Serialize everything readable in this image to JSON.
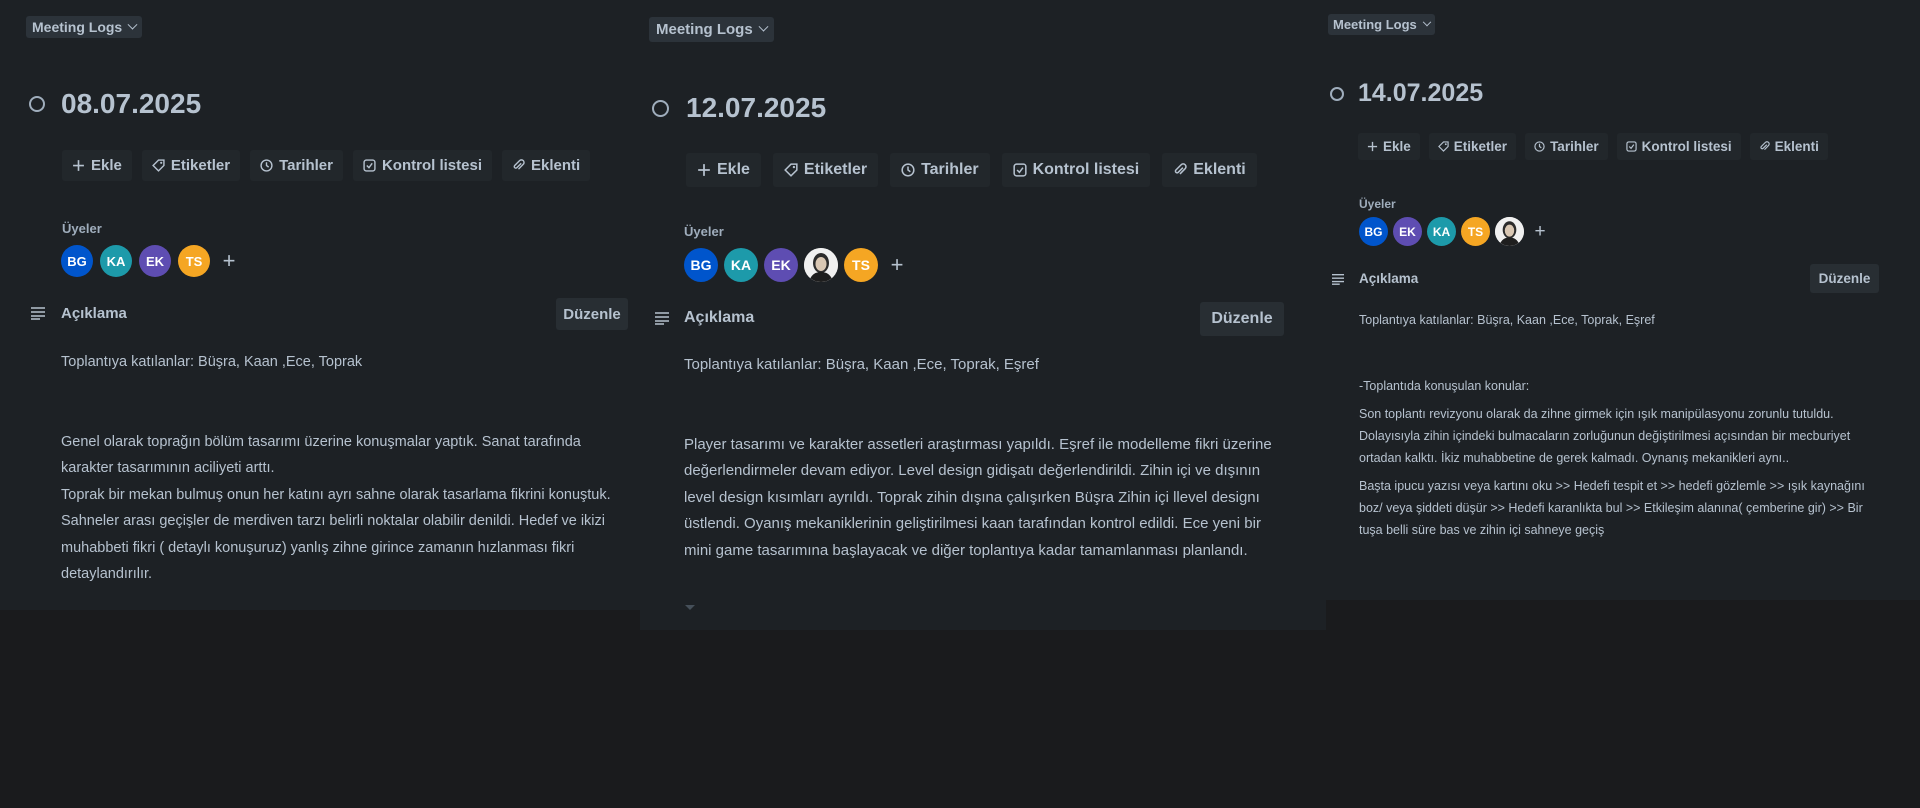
{
  "colors": {
    "background": "#1d2125",
    "text": "#b6c2cf",
    "button_bg": "#22272b",
    "avatar_BG": "#0055cc",
    "avatar_KA": "#1d9aaa",
    "avatar_EK": "#5e4db2",
    "avatar_TS": "#f5a623"
  },
  "cards": [
    {
      "list_label": "Meeting Logs",
      "title": "08.07.2025",
      "actions": [
        "Ekle",
        "Etiketler",
        "Tarihler",
        "Kontrol listesi",
        "Eklenti"
      ],
      "members_label": "Üyeler",
      "members": [
        "BG",
        "KA",
        "EK",
        "TS"
      ],
      "description_title": "Açıklama",
      "edit_label": "Düzenle",
      "description": [
        "Toplantıya katılanlar: Büşra, Kaan ,Ece, Toprak",
        "",
        "",
        "Genel olarak toprağın bölüm tasarımı üzerine konuşmalar yaptık. Sanat tarafında karakter  tasarımının aciliyeti arttı.",
        "Toprak bir mekan bulmuş onun her katını ayrı sahne olarak tasarlama fikrini konuştuk. Sahneler arası geçişler de merdiven tarzı belirli noktalar olabilir denildi. Hedef ve ikizi muhabbeti fikri ( detaylı konuşuruz) yanlış zihne girince zamanın hızlanması fikri detaylandırılır."
      ]
    },
    {
      "list_label": "Meeting Logs",
      "title": "12.07.2025",
      "actions": [
        "Ekle",
        "Etiketler",
        "Tarihler",
        "Kontrol listesi",
        "Eklenti"
      ],
      "members_label": "Üyeler",
      "members": [
        "BG",
        "KA",
        "EK",
        "photo",
        "TS"
      ],
      "description_title": "Açıklama",
      "edit_label": "Düzenle",
      "description": [
        "Toplantıya katılanlar: Büşra, Kaan ,Ece, Toprak, Eşref",
        "",
        "",
        "Player tasarımı ve karakter assetleri araştırması yapıldı. Eşref ile modelleme fikri üzerine değerlendirmeler devam ediyor. Level design gidişatı değerlendirildi. Zihin içi ve dışının level design kısımları ayrıldı. Toprak zihin dışına çalışırken Büşra Zihin içi llevel designı üstlendi. Oyanış mekaniklerinin geliştirilmesi kaan tarafından kontrol edildi. Ece yeni bir mini game tasarımına başlayacak ve diğer toplantıya kadar tamamlanması planlandı."
      ]
    },
    {
      "list_label": "Meeting Logs",
      "title": "14.07.2025",
      "actions": [
        "Ekle",
        "Etiketler",
        "Tarihler",
        "Kontrol listesi",
        "Eklenti"
      ],
      "members_label": "Üyeler",
      "members": [
        "BG",
        "EK",
        "KA",
        "TS",
        "photo"
      ],
      "description_title": "Açıklama",
      "edit_label": "Düzenle",
      "description": [
        "Toplantıya katılanlar: Büşra, Kaan ,Ece, Toprak, Eşref",
        "",
        "",
        "-Toplantıda konuşulan konular:",
        "Son toplantı revizyonu olarak da zihne girmek için ışık manipülasyonu zorunlu tutuldu. Dolayısıyla zihin içindeki bulmacaların zorluğunun değiştirilmesi açısından bir mecburiyet ortadan kalktı. İkiz muhabbetine de gerek kalmadı. Oynanış mekanikleri aynı..",
        "Başta ipucu yazısı veya kartını oku  >> Hedefi tespit et >>  hedefi gözlemle >> ışık kaynağını boz/ veya şiddeti düşür >> Hedefi karanlıkta bul  >> Etkileşim alanına( çemberine gir) >> Bir tuşa belli süre bas ve zihin içi sahneye geçiş"
      ]
    }
  ]
}
